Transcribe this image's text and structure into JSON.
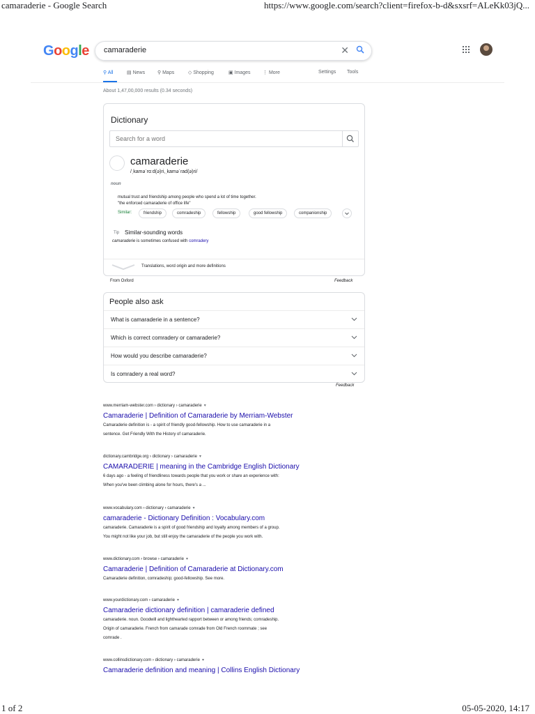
{
  "print": {
    "title": "camaraderie - Google Search",
    "url": "https://www.google.com/search?client=firefox-b-d&sxsrf=ALeKk03jQ...",
    "page": "1 of 2",
    "datetime": "05-05-2020, 14:17"
  },
  "logo": {
    "g1": "G",
    "o1": "o",
    "o2": "o",
    "g2": "g",
    "l": "l",
    "e": "e"
  },
  "search": {
    "query": "camaraderie"
  },
  "tabs": {
    "all": "All",
    "news": "News",
    "maps": "Maps",
    "shopping": "Shopping",
    "images": "Images",
    "more": "More",
    "settings": "Settings",
    "tools": "Tools"
  },
  "stats": "About 1,47,00,000 results (0.34 seconds)",
  "dictionary": {
    "title": "Dictionary",
    "search_placeholder": "Search for a word",
    "word": "camaraderie",
    "phonetic": "/ˌkaməˈrɑːd(ə)ri,ˌkaməˈrad(ə)ri/",
    "pos": "noun",
    "definition": "mutual trust and friendship among people who spend a lot of time together.",
    "example": "\"the enforced camaraderie of office life\"",
    "similar_label": "Similar:",
    "similar": [
      "friendship",
      "comradeship",
      "fellowship",
      "good fellowship",
      "companionship"
    ],
    "tip_label": "Tip",
    "tip_title": "Similar-sounding words",
    "tip_word": "camaraderie",
    "tip_mid": " is sometimes confused with ",
    "tip_link": "comradery",
    "translations": "Translations, word origin and more definitions",
    "from": "From Oxford",
    "feedback": "Feedback"
  },
  "paa": {
    "title": "People also ask",
    "questions": [
      "What is camaraderie in a sentence?",
      "Which is correct comradery or camaraderie?",
      "How would you describe camaraderie?",
      "Is comradery a real word?"
    ],
    "feedback": "Feedback"
  },
  "results": [
    {
      "url": "www.merriam-webster.com › dictionary › camaraderie",
      "title": "Camaraderie | Definition of Camaraderie by Merriam-Webster",
      "snippet": [
        "Camaraderie definition is - a spirit of friendly good-fellowship. How to use camaraderie in a",
        "sentence. Get Friendly With the History of camaraderie."
      ]
    },
    {
      "url": "dictionary.cambridge.org › dictionary › camaraderie",
      "title": "CAMARADERIE | meaning in the Cambridge English Dictionary",
      "snippet": [
        "6 days ago - a feeling of friendliness towards people that you work or share an experience with:",
        "When you've been climbing alone for hours, there's a ..."
      ]
    },
    {
      "url": "www.vocabulary.com › dictionary › camaraderie",
      "title": "camaraderie - Dictionary Definition : Vocabulary.com",
      "snippet": [
        "camaraderie. Camaraderie is a spirit of good friendship and loyalty among members of a group.",
        "You might not like your job, but still enjoy the camaraderie of the people you work with."
      ]
    },
    {
      "url": "www.dictionary.com › browse › camaraderie",
      "title": "Camaraderie | Definition of Camaraderie at Dictionary.com",
      "snippet": [
        "Camaraderie definition, comradeship; good-fellowship. See more."
      ]
    },
    {
      "url": "www.yourdictionary.com › camaraderie",
      "title": "Camaraderie dictionary definition | camaraderie defined",
      "snippet": [
        "camaraderie. noun. Goodwill and lighthearted rapport between or among friends; comradeship.",
        "Origin of camaraderie. French from camarade comrade from Old French roommate ; see",
        "comrade ."
      ]
    },
    {
      "url": "www.collinsdictionary.com › dictionary › camaraderie",
      "title": "Camaraderie definition and meaning | Collins English Dictionary",
      "snippet": []
    }
  ]
}
